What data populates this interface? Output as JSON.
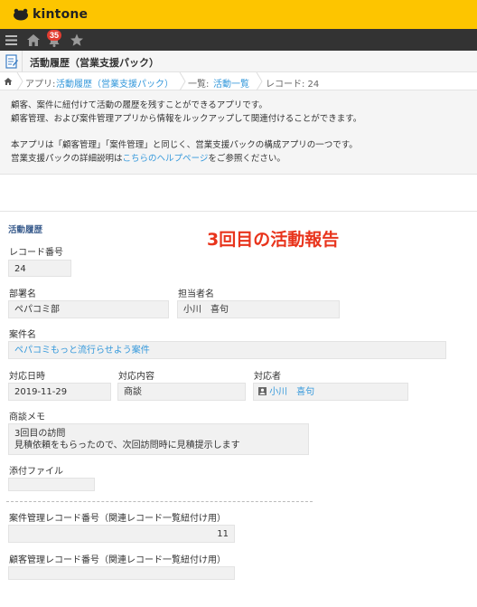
{
  "header": {
    "logo_text": "kintone",
    "notification_count": "35"
  },
  "nav": {
    "icons": [
      "menu-icon",
      "home-icon",
      "bell-icon",
      "star-icon"
    ]
  },
  "app": {
    "title": "活動履歴（営業支援パック）"
  },
  "breadcrumb": {
    "app_prefix": "アプリ: ",
    "app_link": "活動履歴（営業支援パック）",
    "list_prefix": "一覧: ",
    "list_link": "活動一覧",
    "record": "レコード: 24"
  },
  "description": {
    "line1": "顧客、案件に紐付けて活動の履歴を残すことができるアプリです。",
    "line2": "顧客管理、および案件管理アプリから情報をルックアップして関連付けることができます。",
    "line3": "本アプリは「顧客管理」「案件管理」と同じく、営業支援パックの構成アプリの一つです。",
    "line4_prefix": "営業支援パックの詳細説明は",
    "line4_link": "こちらのヘルプページ",
    "line4_suffix": "をご参照ください。"
  },
  "form": {
    "group_label": "活動履歴",
    "report_title": "3回目の活動報告",
    "record_no": {
      "label": "レコード番号",
      "value": "24"
    },
    "department": {
      "label": "部署名",
      "value": "ペパコミ部"
    },
    "person": {
      "label": "担当者名",
      "value": "小川　喜句"
    },
    "case_name": {
      "label": "案件名",
      "value": "ペパコミもっと流行らせよう案件"
    },
    "date": {
      "label": "対応日時",
      "value": "2019-11-29"
    },
    "content": {
      "label": "対応内容",
      "value": "商談"
    },
    "responder": {
      "label": "対応者",
      "value": "小川　喜句"
    },
    "memo": {
      "label": "商談メモ",
      "line1": "3回目の訪問",
      "line2": "見積依頼をもらったので、次回訪問時に見積提示します"
    },
    "attachment": {
      "label": "添付ファイル",
      "value": ""
    },
    "case_record_no": {
      "label": "案件管理レコード番号（関連レコード一覧紐付け用）",
      "value": "11"
    },
    "customer_record_no": {
      "label": "顧客管理レコード番号（関連レコード一覧紐付け用）",
      "value": ""
    }
  },
  "colors": {
    "header_yellow": "#fdc500",
    "navbar": "#333333",
    "link_blue": "#3498db",
    "title_red": "#e8341c",
    "badge_red": "#e23d31"
  }
}
